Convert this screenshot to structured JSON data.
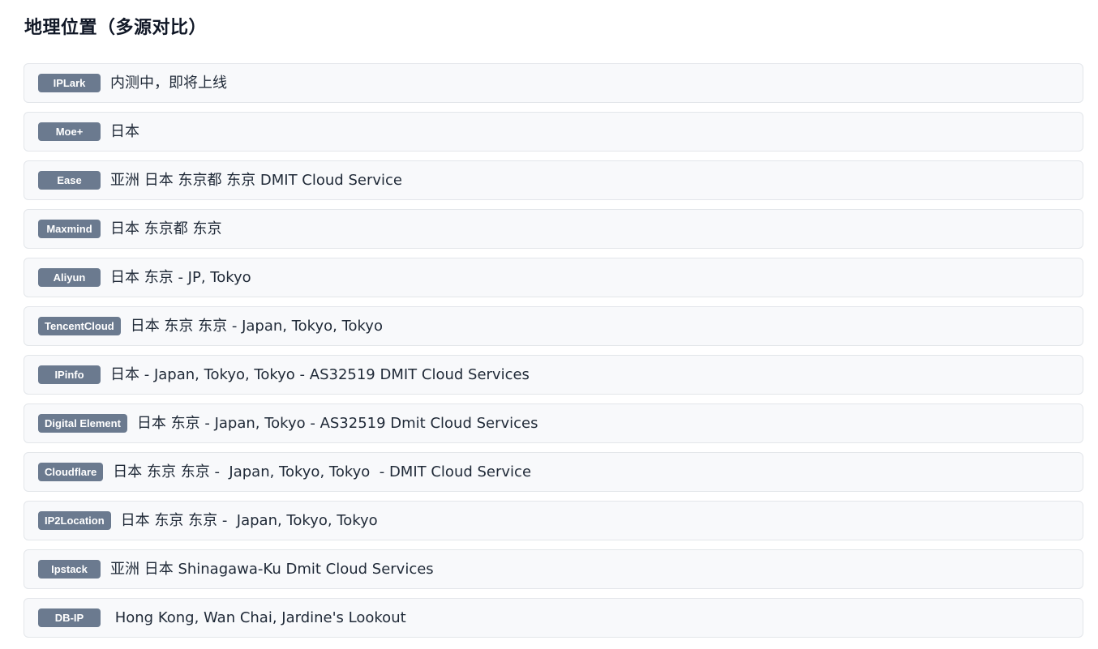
{
  "page": {
    "title": "地理位置（多源对比）"
  },
  "rows": [
    {
      "source": "IPLark",
      "value": "内测中，即将上线"
    },
    {
      "source": "Moe+",
      "value": "日本"
    },
    {
      "source": "Ease",
      "value": "亚洲 日本 东京都 东京 DMIT Cloud Service"
    },
    {
      "source": "Maxmind",
      "value": "日本 东京都 东京"
    },
    {
      "source": "Aliyun",
      "value": "日本 东京 - JP, Tokyo"
    },
    {
      "source": "TencentCloud",
      "value": "日本 东京 东京 - Japan, Tokyo, Tokyo"
    },
    {
      "source": "IPinfo",
      "value": "日本 - Japan, Tokyo, Tokyo - AS32519 DMIT Cloud Services"
    },
    {
      "source": "Digital Element",
      "value": "日本 东京 - Japan, Tokyo - AS32519 Dmit Cloud Services"
    },
    {
      "source": "Cloudflare",
      "value": "日本 东京 东京 -  Japan, Tokyo, Tokyo  - DMIT Cloud Service"
    },
    {
      "source": "IP2Location",
      "value": "日本 东京 东京 -  Japan, Tokyo, Tokyo"
    },
    {
      "source": "Ipstack",
      "value": "亚洲 日本 Shinagawa-Ku Dmit Cloud Services"
    },
    {
      "source": "DB-IP",
      "value": " Hong Kong, Wan Chai, Jardine's Lookout"
    }
  ]
}
